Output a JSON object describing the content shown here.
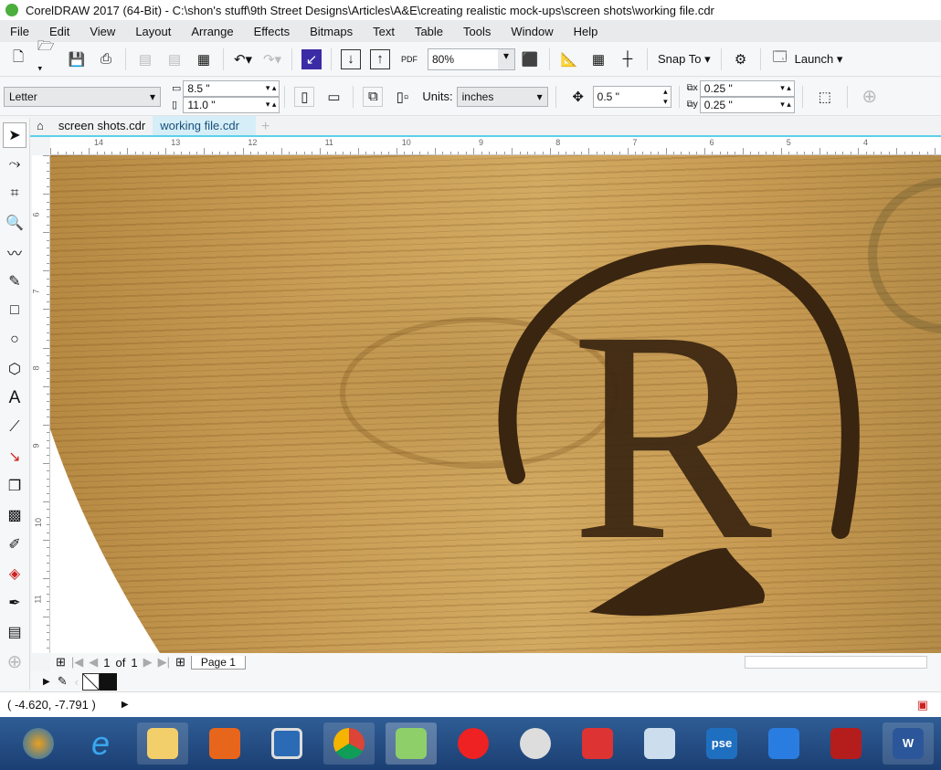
{
  "title": "CorelDRAW 2017 (64-Bit) - C:\\shon's stuff\\9th Street Designs\\Articles\\A&E\\creating realistic mock-ups\\screen shots\\working file.cdr",
  "menu": [
    "File",
    "Edit",
    "View",
    "Layout",
    "Arrange",
    "Effects",
    "Bitmaps",
    "Text",
    "Table",
    "Tools",
    "Window",
    "Help"
  ],
  "toolbar": {
    "zoom": "80%",
    "snap": "Snap To",
    "launch": "Launch",
    "pdf": "PDF"
  },
  "property_bar": {
    "page_size": "Letter",
    "width": "8.5 \"",
    "height": "11.0 \"",
    "units_label": "Units:",
    "units": "inches",
    "nudge": "0.5 \"",
    "dup_x": "0.25 \"",
    "dup_y": "0.25 \""
  },
  "tabs": [
    "screen shots.cdr",
    "working file.cdr"
  ],
  "ruler_h": [
    "14",
    "13",
    "12",
    "11",
    "10",
    "9",
    "8",
    "7",
    "6",
    "5",
    "4"
  ],
  "ruler_v": [
    "6",
    "7",
    "8",
    "9",
    "10",
    "11"
  ],
  "canvas": {
    "monogram": "R"
  },
  "page_nav": {
    "current": "1",
    "of": "of",
    "total": "1",
    "page_tab": "Page 1"
  },
  "status": {
    "coords": "( -4.620, -7.791 )"
  },
  "colors": {
    "accent": "#5bd0ea",
    "taskbar": "#1f4a82",
    "wood": "#c99d55",
    "burn": "#3a2510"
  }
}
